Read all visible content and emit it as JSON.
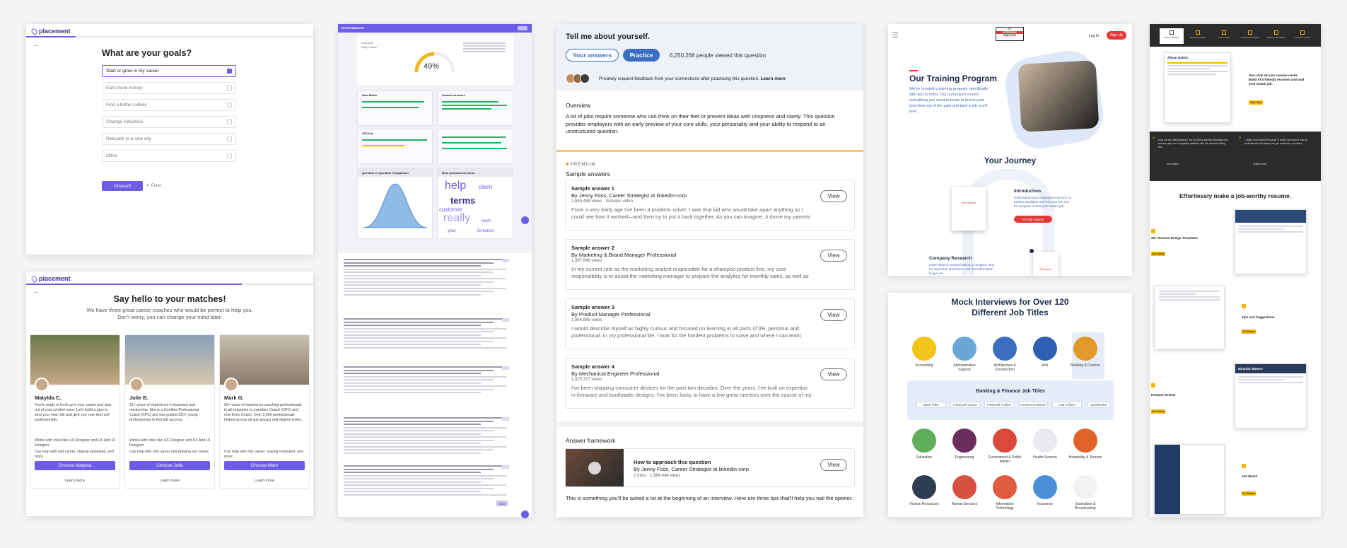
{
  "goals": {
    "logo": "placement",
    "title": "What are your goals?",
    "options": [
      "Start or grow in my career",
      "Earn more money",
      "Find a better culture",
      "Change industries",
      "Relocate to a new city",
      "Other"
    ],
    "selected_index": 0,
    "submit_label": "Onward!",
    "enter_hint": "↵ Enter"
  },
  "matches": {
    "logo": "placement",
    "title": "Say hello to your matches!",
    "subtitle": "We have three great career coaches who would be perfect to help you. Don't worry, you can change your mind later.",
    "coaches": [
      {
        "name": "Matylda C.",
        "desc": "You're ready to level up in your career and step out of your comfort zone. Let's build a plan to land your next role and give you your best self professionally.",
        "f1": "Works with roles like UX Designer and UX And UI Designer",
        "f2": "Can help with mid career, staying motivated, and more",
        "button": "Choose Matylda",
        "learn": "Learn more"
      },
      {
        "name": "Jolie B.",
        "desc": "21+ years of experience in business and mentorship. She is a Certified Professional Coach (CPC) and has guided 320+ young professionals to find job success.",
        "f1": "Works with roles like UX Designer and UX And UI Designer",
        "f2": "Can help with mid career and growing our career",
        "button": "Choose Jolie",
        "learn": "Learn more"
      },
      {
        "name": "Mark G.",
        "desc": "30+ years of experience coaching professionals in all industries to transition Coach (CPC) and now Exec Coach. Over 3,000 professionals helped across all age groups and degree levels.",
        "f1": "",
        "f2": "Can help with mid career, staying motivated, and more",
        "button": "Choose Mark",
        "learn": "Learn more"
      }
    ]
  },
  "report": {
    "brand": "INTERVIEWINGIO",
    "score_label": "Overall fit",
    "score_sub": "Early review",
    "score": "49%",
    "score_value": 0.49,
    "sections": [
      "Role Match",
      "Answer structure",
      "ATS/Lite",
      "Question vs Question Comparison",
      "Most pronounced words"
    ],
    "words": [
      "help",
      "client",
      "terms",
      "customer",
      "really",
      "Direction",
      "team",
      "year"
    ],
    "button": "Next"
  },
  "question": {
    "title": "Tell me about yourself.",
    "tab_answers": "Your answers",
    "tab_practice": "Practice",
    "viewed": "6,250,268 people viewed this question",
    "feedback": "Privately request feedback from your connections after practicing this question.",
    "learn_more": "Learn more",
    "overview_h": "Overview",
    "overview": "A lot of jobs require someone who can think on their feet or present ideas with crispness and clarity. This question provides employers with an early preview of your core skills, your personality and your ability to respond to an unstructured question.",
    "premium": "PREMIUM",
    "sample_h": "Sample answers",
    "answers": [
      {
        "h": "Sample answer 1",
        "by": "By Jenny Foss, Career Strategist at linkedin-corp",
        "v": "2,845,488 views · Includes video",
        "ex": "From a very early age I've been a problem solver. I was that kid who would take apart anything so I could see how it worked—and then try to put it back together. As you can imagine, it drove my parents nuts. But even…"
      },
      {
        "h": "Sample answer 2",
        "by": "By Marketing & Brand Manager Professional",
        "v": "1,987,846 views",
        "ex": "In my current role as the marketing analyst responsible for a shampoo product line, my core responsibility is to assist the marketing manager to prepare the analytics for monthly sales, as well as a sales prediction…"
      },
      {
        "h": "Sample answer 3",
        "by": "By Product Manager Professional",
        "v": "1,864,885 views",
        "ex": "I would describe myself as highly curious and focused on learning in all parts of life, personal and professional. In my professional life, I look for the hardest problems to solve and where I can learn and…"
      },
      {
        "h": "Sample answer 4",
        "by": "By Mechanical Engineer Professional",
        "v": "1,475,727 views",
        "ex": "I've been shipping consumer devices for the past two decades. Over the years, I've built an expertise in firmware and bootloader designs. I've been lucky to have a few great mentors over the course of my career…"
      }
    ],
    "view_label": "View",
    "framework_h": "Answer framework",
    "framework_t": "How to approach this question",
    "framework_by": "By Jenny Foss, Career Strategist at linkedin-corp",
    "framework_v": "2 mins · 1,964,444 views",
    "framework_ex": "This is something you'll be asked a lot at the beginning of an interview. Here are three tips that'll help you nail the opener."
  },
  "training": {
    "logo_top": "MY",
    "logo_main": "INTERVIEW",
    "logo_bot": "PRACTICE",
    "login": "Log In",
    "signup": "Sign Up",
    "title": "Our Training Program",
    "body": "We've created a training program specifically with you in mind. Our curriculum covers everything you need to know to knock your interview out of the park and land a job you'll love.",
    "journey": "Your Journey",
    "intro_h": "Introduction",
    "intro_t": "Understand what employers look for in a perfect candidate and how you can use the program to land your dream job.",
    "intro_btn": "Get the Lesson",
    "research_h": "Company Research",
    "research_t": "Learn what to research about a company, why it's important, and how to use that information to give an…",
    "book_label": "Introduction",
    "book2_label": "Research"
  },
  "mock": {
    "title": "Mock Interviews for Over 120 Different Job Titles",
    "row1": [
      "Accounting",
      "Administrative Support",
      "Architecture & Construction",
      "Arts",
      "Banking & Finance"
    ],
    "subhead": "Banking & Finance Job Titles",
    "tags": [
      "Bank Teller",
      "Financial Advisor",
      "Financial Analyst",
      "Investment Banker",
      "Loan Officer",
      "Stockbroker"
    ],
    "row2": [
      "Education",
      "Engineering",
      "Government & Public Admin",
      "Health Science",
      "Hospitality & Tourism"
    ],
    "row3": [
      "Human Resources",
      "Human Services",
      "Information Technology",
      "Insurance",
      "Journalism & Broadcasting"
    ],
    "colors1": [
      "#f2c318",
      "#6aa6d8",
      "#3c6fbf",
      "#2f5fb0",
      "#e09a2a"
    ],
    "colors2": [
      "#5fae5c",
      "#6b2d5c",
      "#d94a3c",
      "#e9e9ef",
      "#e0632a"
    ],
    "colors3": [
      "#2c3e50",
      "#d6513f",
      "#e05b40",
      "#4a8fd8",
      "#f2f2f2"
    ]
  },
  "resume": {
    "nav": [
      "Resume Builder",
      "Resume Guides",
      "Cover Letter",
      "Resume Examples",
      "Resume Templates",
      "Resume Check"
    ],
    "hero_t": "One-click all your resume needs. Build ATS-friendly resumes and land your dream job.",
    "hero_btn": "Start Here",
    "t1": "How did the editing feature, the AI review and the templates this resume gave are completely satisfied with the resume editing tool.",
    "t2": "I highly recommend Resumly! It made my resume look so professional and helped me get noticed by recruiters.",
    "a1": "Ana Mateo",
    "a2": "Jessica Hall",
    "headline": "Effortlessly make a job-worthy resume.",
    "f1": "25+ Resume Design Templates",
    "f2": "Tips and Suggestions",
    "f3": "Resume Review",
    "f4": "Job Match",
    "cta": "Get Started",
    "names": [
      "Alison Daters",
      "Miranda Watson"
    ]
  }
}
